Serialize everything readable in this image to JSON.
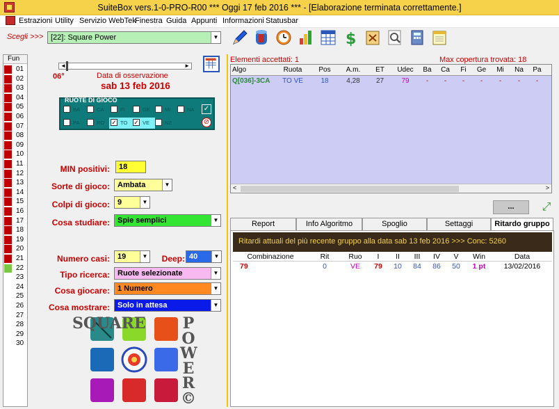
{
  "window": {
    "title": "SuiteBox vers.1-0-PRO-R00  ***  Oggi 17 feb 2016  ***   - [Elaborazione terminata correttamente.]"
  },
  "menu": [
    "Estrazioni",
    "Utility",
    "Servizio WebTek",
    "Finestra",
    "Guida",
    "Appunti",
    "Informazioni",
    "Statusbar"
  ],
  "scegli": {
    "label": "Scegli >>>",
    "value": "[22]: Square Power"
  },
  "toolbar": [
    "pencil-icon",
    "database-icon",
    "clock-icon",
    "bar-chart-icon",
    "calculator-grid-icon",
    "dollar-icon",
    "scroll-icon",
    "magnifier-icon",
    "calculator-icon",
    "notepad-icon"
  ],
  "fun": {
    "header": "Fun",
    "items": [
      "01",
      "02",
      "03",
      "04",
      "05",
      "06",
      "07",
      "08",
      "09",
      "10",
      "11",
      "12",
      "13",
      "14",
      "15",
      "16",
      "17",
      "18",
      "19",
      "20",
      "21",
      "22",
      "23",
      "24",
      "25",
      "26",
      "27",
      "28",
      "29",
      "30"
    ]
  },
  "obs": {
    "degree": "06°",
    "label": "Data di osservazione",
    "date": "sab 13 feb 2016"
  },
  "ruote": {
    "title": "RUOTE DI GIOCO",
    "row1": [
      "BA",
      "CA",
      "FI",
      "GE",
      "MI",
      "NA"
    ],
    "row2": [
      "PA",
      "RO",
      "TO",
      "VE",
      "NZ"
    ]
  },
  "form": {
    "min_positivi_label": "MIN positivi:",
    "min_positivi": "18",
    "sorte_label": "Sorte di gioco:",
    "sorte": "Ambata",
    "colpi_label": "Colpi di gioco:",
    "colpi": "9",
    "studiare_label": "Cosa studiare:",
    "studiare": "Spie semplici",
    "casi_label": "Numero casi:",
    "casi": "19",
    "deep_label": "Deep:",
    "deep": "40",
    "ricerca_label": "Tipo ricerca:",
    "ricerca": "Ruote selezionate",
    "giocare_label": "Cosa giocare:",
    "giocare": "1 Numero",
    "mostrare_label": "Cosa mostrare:",
    "mostrare": "Solo in attesa"
  },
  "logo": {
    "left": "SQUARE",
    "right": "POWER©"
  },
  "grid": {
    "accepted": "Elementi accettati: 1",
    "max": "Max copertura trovata:   18",
    "headers": [
      "Algo",
      "Ruota",
      "Pos",
      "A.m.",
      "ET",
      "Udec",
      "Ba",
      "Ca",
      "Fi",
      "Ge",
      "Mi",
      "Na",
      "Pa"
    ],
    "row": [
      "Q[036]-3CA",
      "TO VE",
      "18",
      "4,28",
      "27",
      "79",
      "-",
      "-",
      "-",
      "-",
      "-",
      "-",
      "-"
    ]
  },
  "more_btn": "...",
  "tabs": [
    "Report",
    "Info Algoritmo",
    "Spoglio",
    "Settaggi",
    "Ritardo gruppo"
  ],
  "ritardi": {
    "banner": "Ritardi attuali del più recente gruppo alla data sab 13 feb 2016 >>> Conc: 5260",
    "headers": [
      "Combinazione",
      "Rit",
      "Ruo",
      "I",
      "II",
      "III",
      "IV",
      "V",
      "Win",
      "Data"
    ],
    "row": [
      "79",
      "0",
      "VE",
      "79",
      "10",
      "84",
      "86",
      "50",
      "1 pt",
      "13/02/2016"
    ]
  },
  "colors": {
    "title": "#f5d24a",
    "accent_red": "#cc0000",
    "ruote_bg": "#0f7a7a",
    "grid_bg": "#ccccf5"
  }
}
